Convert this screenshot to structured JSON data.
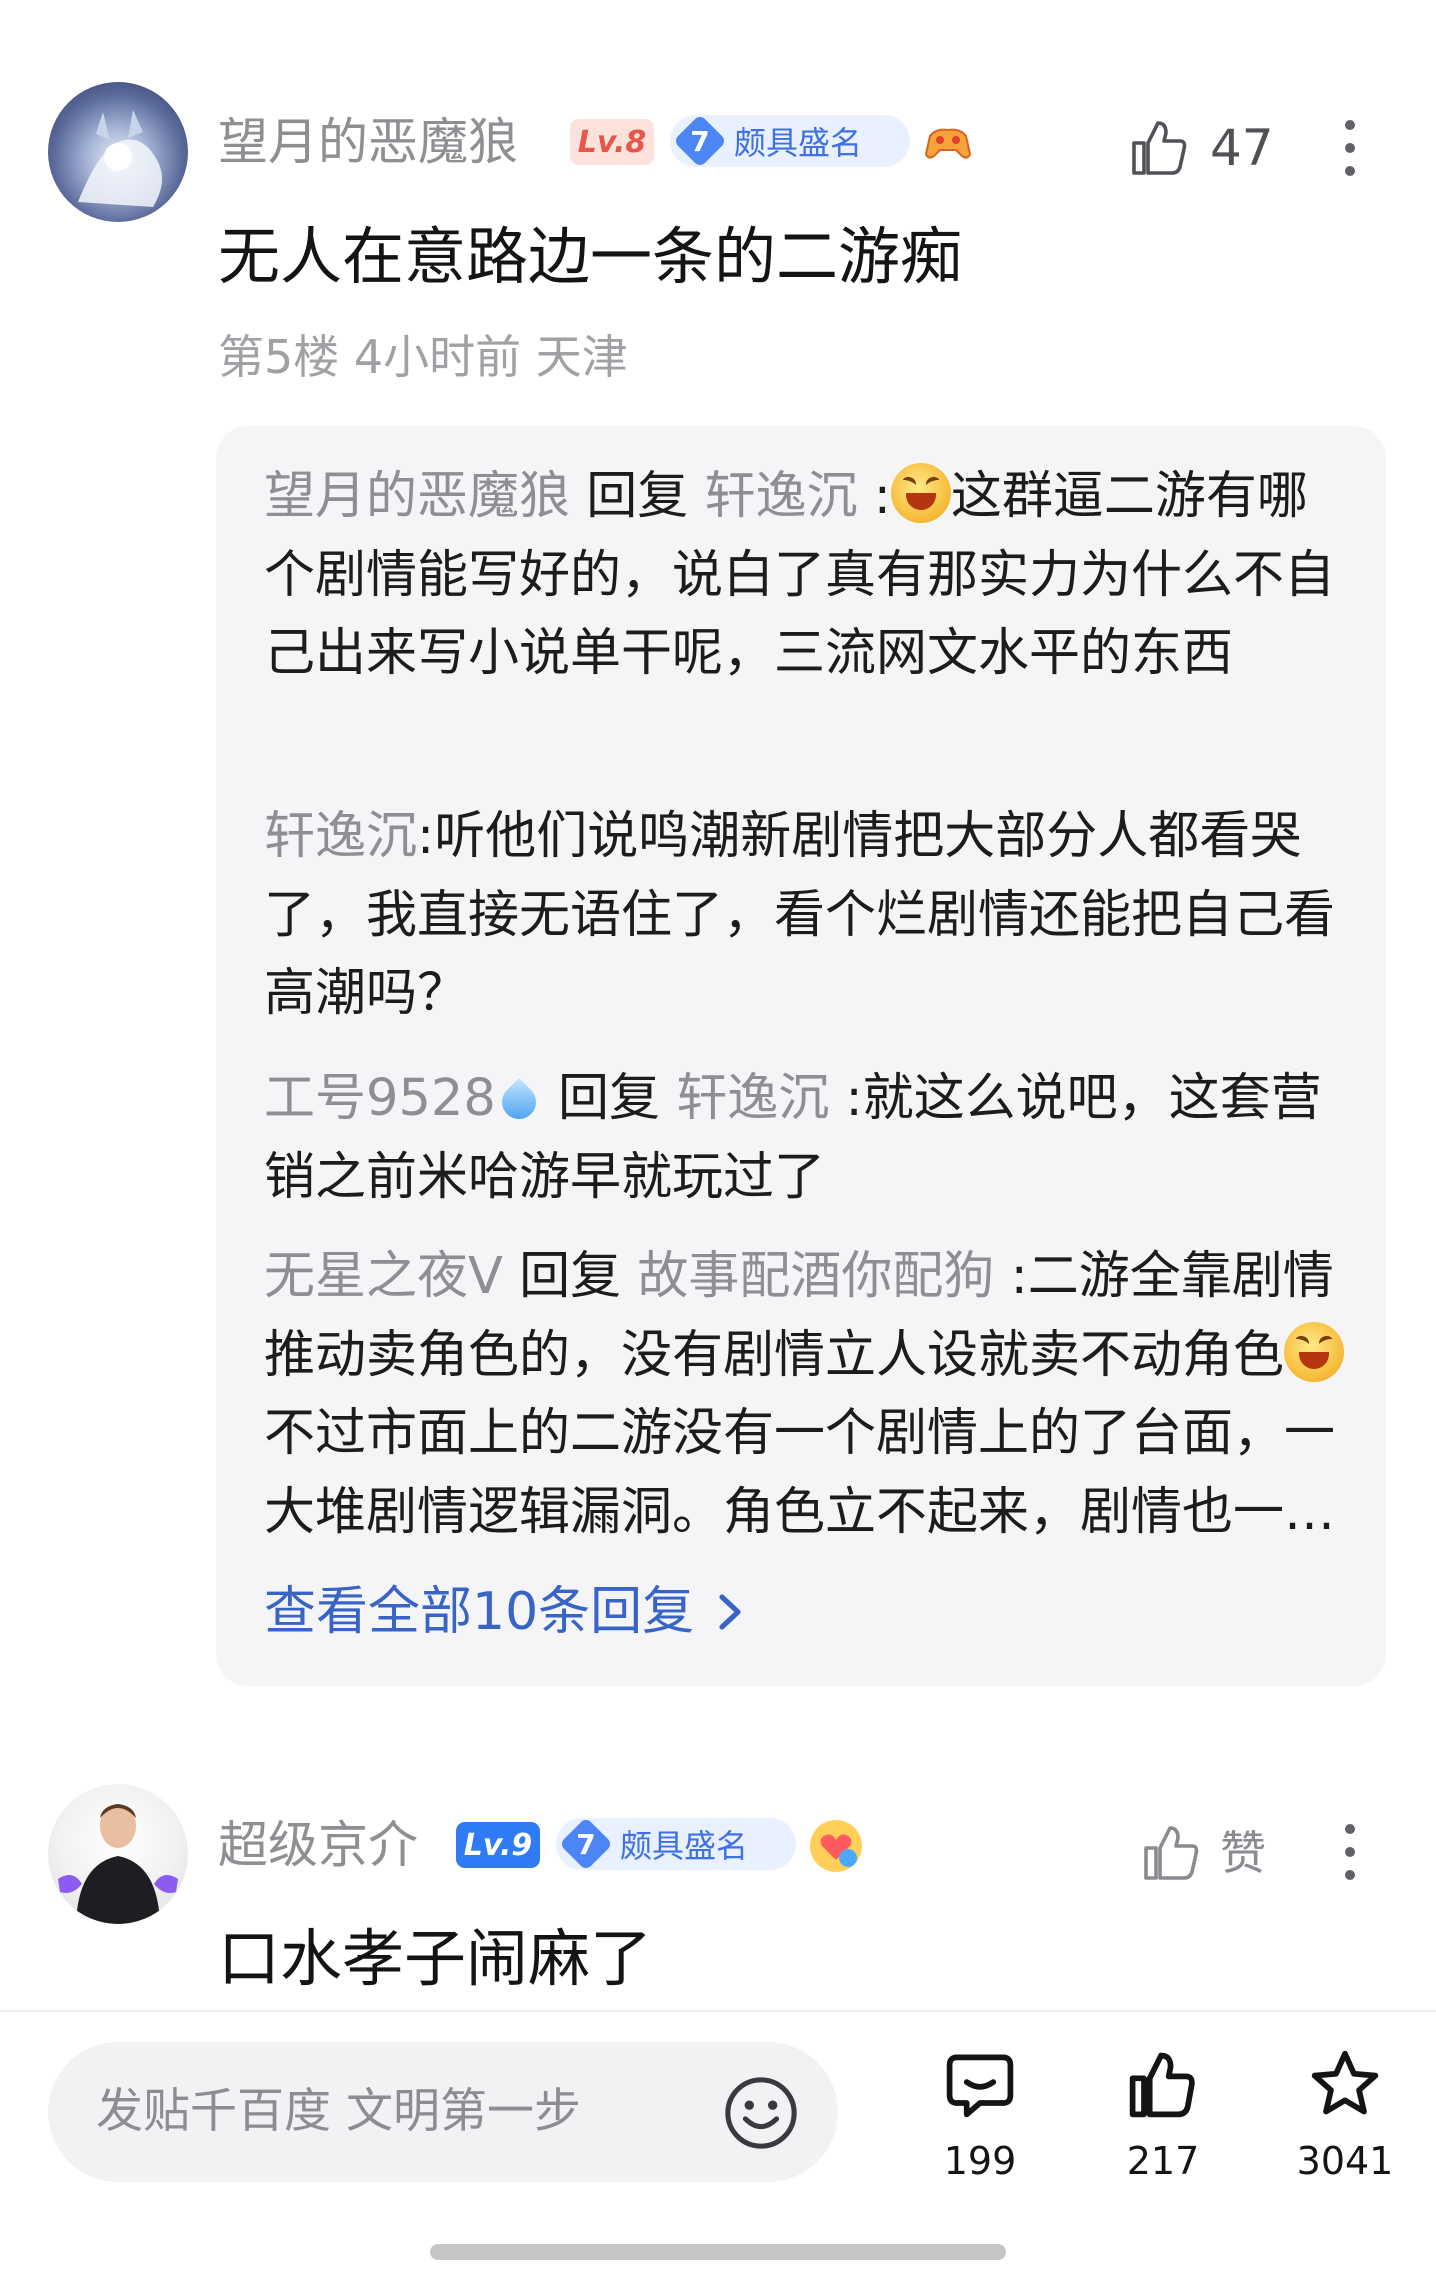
{
  "comment1": {
    "username": "望月的恶魔狼",
    "level": "Lv.8",
    "rep_level": "7",
    "rep_title": "颇具盛名",
    "like_count": "47",
    "text": "无人在意路边一条的二游痴",
    "meta": "第5楼 4小时前 天津",
    "replies": [
      {
        "from": "望月的恶魔狼",
        "verb": "回复",
        "to": "轩逸沉",
        "colon": " :",
        "pre": "",
        "post": "这群逼二游有哪个剧情能写好的，说白了真有那实力为什么不自己出来写小说单干呢，三流网文水平的东西"
      },
      {
        "from": "轩逸沉",
        "verb": "",
        "to": "",
        "colon": ":",
        "pre": "听他们说鸣潮新剧情把大部分人都看哭了，我直接无语住了，看个烂剧情还能把自己看高潮吗？",
        "post": ""
      },
      {
        "from": "工号9528",
        "verb": "回复",
        "to": "轩逸沉",
        "colon": " :",
        "pre": "就这么说吧，这套营销之前米哈游早就玩过了",
        "post": ""
      },
      {
        "from": "无星之夜V",
        "verb": "回复",
        "to": "故事配酒你配狗",
        "colon": " :",
        "pre": "二游全靠剧情推动卖角色的，没有剧情立人设就卖不动角色",
        "post": "不过市面上的二游没有一个剧情上的了台面，一大堆剧情逻辑漏洞。角色立不起来，剧情也一塌糊涂"
      }
    ],
    "view_all": "查看全部10条回复"
  },
  "comment2": {
    "username": "超级京介",
    "level": "Lv.9",
    "rep_level": "7",
    "rep_title": "颇具盛名",
    "like_label": "赞",
    "text": "口水孝子闹麻了"
  },
  "bottom": {
    "placeholder": "发贴千百度 文明第一步",
    "comments_count": "199",
    "likes_count": "217",
    "favorites_count": "3041"
  },
  "icons": {
    "like": "thumbs-up-icon",
    "more": "more-vertical-icon",
    "emoji": "smiley-icon",
    "comment": "comment-bubble-icon",
    "favorite": "star-icon",
    "chevron": "chevron-right-icon"
  },
  "colors": {
    "link_blue": "#3864c7",
    "username_gray": "#8e8e93",
    "reply_box_bg": "#f5f5f7",
    "level8": "#e5574a",
    "level9": "#2f7bf6"
  }
}
